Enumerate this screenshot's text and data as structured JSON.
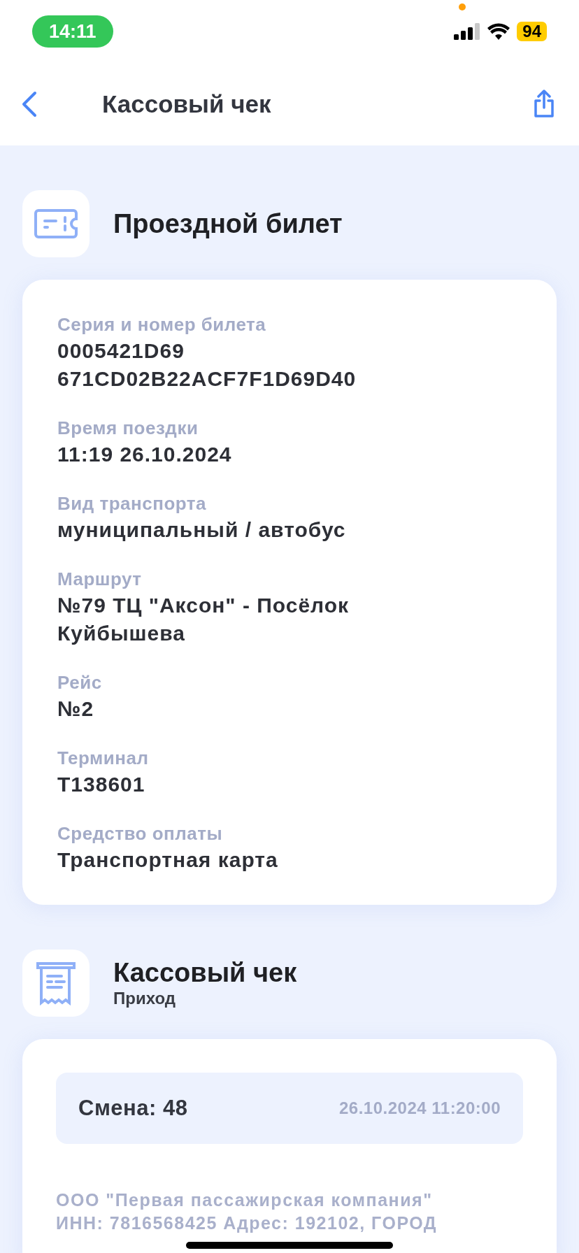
{
  "status_bar": {
    "time": "14:11",
    "battery": "94"
  },
  "header": {
    "title": "Кассовый чек"
  },
  "ticket": {
    "title": "Проездной билет",
    "fields": [
      {
        "label": "Серия и номер билета",
        "value": "0005421D69\n671CD02B22ACF7F1D69D40"
      },
      {
        "label": "Время поездки",
        "value": "11:19 26.10.2024"
      },
      {
        "label": "Вид транспорта",
        "value": "муниципальный / автобус"
      },
      {
        "label": "Маршрут",
        "value": "№79 ТЦ \"Аксон\" - Посёлок\nКуйбышева"
      },
      {
        "label": "Рейс",
        "value": "№2"
      },
      {
        "label": "Терминал",
        "value": "T138601"
      },
      {
        "label": "Средство оплаты",
        "value": "Транспортная карта"
      }
    ]
  },
  "receipt": {
    "title": "Кассовый чек",
    "subtitle": "Приход",
    "shift": "Смена: 48",
    "datetime": "26.10.2024 11:20:00",
    "company_lines": [
      "ООО \"Первая пассажирская компания\"",
      "ИНН: 7816568425 Адрес: 192102, ГОРОД"
    ]
  }
}
